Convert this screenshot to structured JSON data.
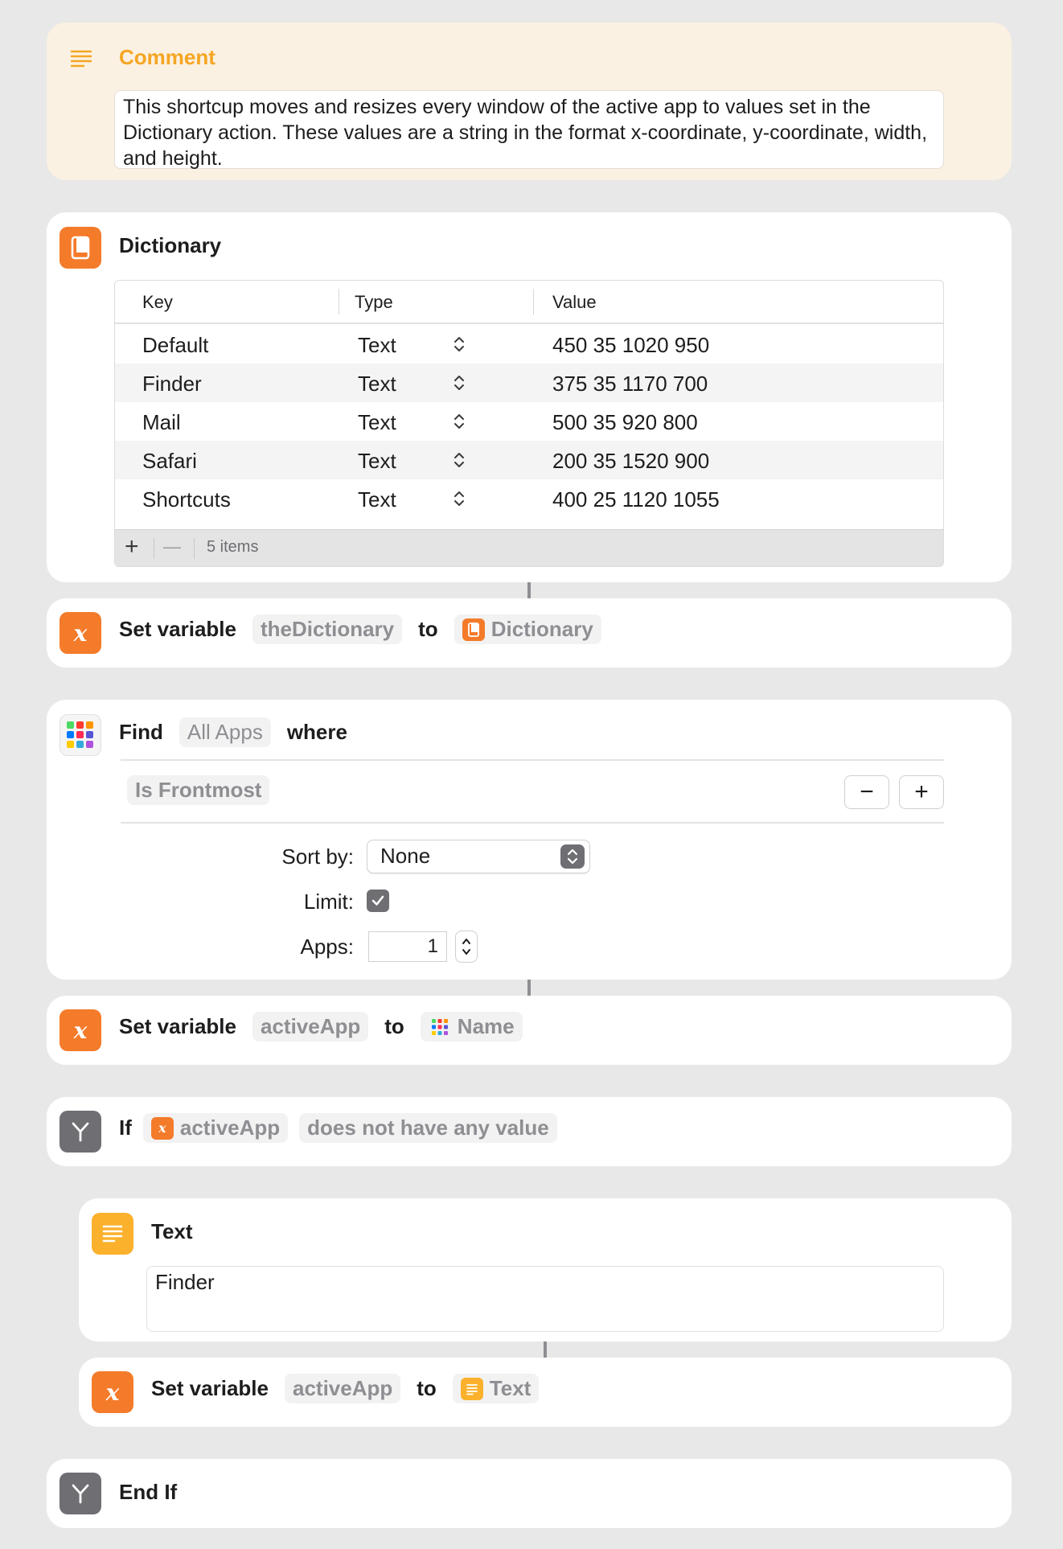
{
  "colors": {
    "orange": "#f47b2a",
    "yellow": "#fbb12c",
    "gray": "#6e6e73",
    "comment_bg": "#fbf1e2",
    "comment_accent": "#f5a623"
  },
  "comment": {
    "icon": "text-lines-icon",
    "title": "Comment",
    "text": "This shortcup moves and resizes every window of the active app to values set in the Dictionary action. These values are a string in the format x-coordinate, y-coordinate, width, and height."
  },
  "dictionary": {
    "icon": "book-icon",
    "title": "Dictionary",
    "headers": {
      "key": "Key",
      "type": "Type",
      "value": "Value"
    },
    "rows": [
      {
        "key": "Default",
        "type": "Text",
        "value": "450 35 1020 950"
      },
      {
        "key": "Finder",
        "type": "Text",
        "value": "375 35 1170 700"
      },
      {
        "key": "Mail",
        "type": "Text",
        "value": "500 35 920 800"
      },
      {
        "key": "Safari",
        "type": "Text",
        "value": "200 35 1520 900"
      },
      {
        "key": "Shortcuts",
        "type": "Text",
        "value": "400 25 1120 1055"
      }
    ],
    "footer": {
      "add": "+",
      "remove": "—",
      "count": "5 items"
    }
  },
  "set_var_1": {
    "icon": "variable-x-icon",
    "label": "Set variable",
    "variable": "theDictionary",
    "to": "to",
    "value": "Dictionary",
    "value_icon": "book-icon"
  },
  "find": {
    "icon": "app-grid-icon",
    "label": "Find",
    "target": "All Apps",
    "where": "where",
    "filter": "Is Frontmost",
    "remove_btn": "−",
    "add_btn": "+",
    "sort_label": "Sort by:",
    "sort_value": "None",
    "limit_label": "Limit:",
    "limit_checked": true,
    "apps_label": "Apps:",
    "apps_value": "1"
  },
  "set_var_2": {
    "icon": "variable-x-icon",
    "label": "Set variable",
    "variable": "activeApp",
    "to": "to",
    "value": "Name",
    "value_icon": "app-grid-icon"
  },
  "if_block": {
    "icon": "branch-icon",
    "label": "If",
    "variable": "activeApp",
    "condition": "does not have any value"
  },
  "text_action": {
    "icon": "text-lines-icon",
    "title": "Text",
    "value": "Finder"
  },
  "set_var_3": {
    "icon": "variable-x-icon",
    "label": "Set variable",
    "variable": "activeApp",
    "to": "to",
    "value": "Text",
    "value_icon": "text-lines-icon"
  },
  "end_if": {
    "icon": "branch-icon",
    "label": "End If"
  }
}
